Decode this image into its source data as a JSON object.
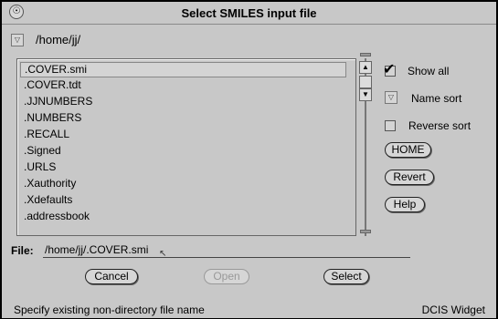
{
  "window": {
    "title": "Select SMILES input file",
    "menu_glyph": "☉"
  },
  "directory": {
    "path": "/home/jj/",
    "menu_glyph": "▽"
  },
  "file_list": {
    "items": [
      ".COVER.smi",
      ".COVER.tdt",
      ".JJNUMBERS",
      ".NUMBERS",
      ".RECALL",
      ".Signed",
      ".URLS",
      ".Xauthority",
      ".Xdefaults",
      ".addressbook"
    ],
    "selected": ".COVER.smi"
  },
  "scrollbar": {
    "up_glyph": "▲",
    "down_glyph": "▼"
  },
  "options": {
    "show_all": {
      "label": "Show all",
      "checked": true,
      "check_glyph": "✔"
    },
    "name_sort": {
      "label": "Name sort",
      "menu_glyph": "▽"
    },
    "reverse_sort": {
      "label": "Reverse sort",
      "checked": false
    }
  },
  "side_buttons": {
    "home": "HOME",
    "revert": "Revert",
    "help": "Help"
  },
  "file_field": {
    "label": "File:",
    "value": "/home/jj/.COVER.smi",
    "cursor_glyph": "↖"
  },
  "actions": {
    "cancel": "Cancel",
    "open": "Open",
    "select": "Select"
  },
  "footer": {
    "status": "Specify existing non-directory file name",
    "widget_name": "DCIS Widget"
  }
}
